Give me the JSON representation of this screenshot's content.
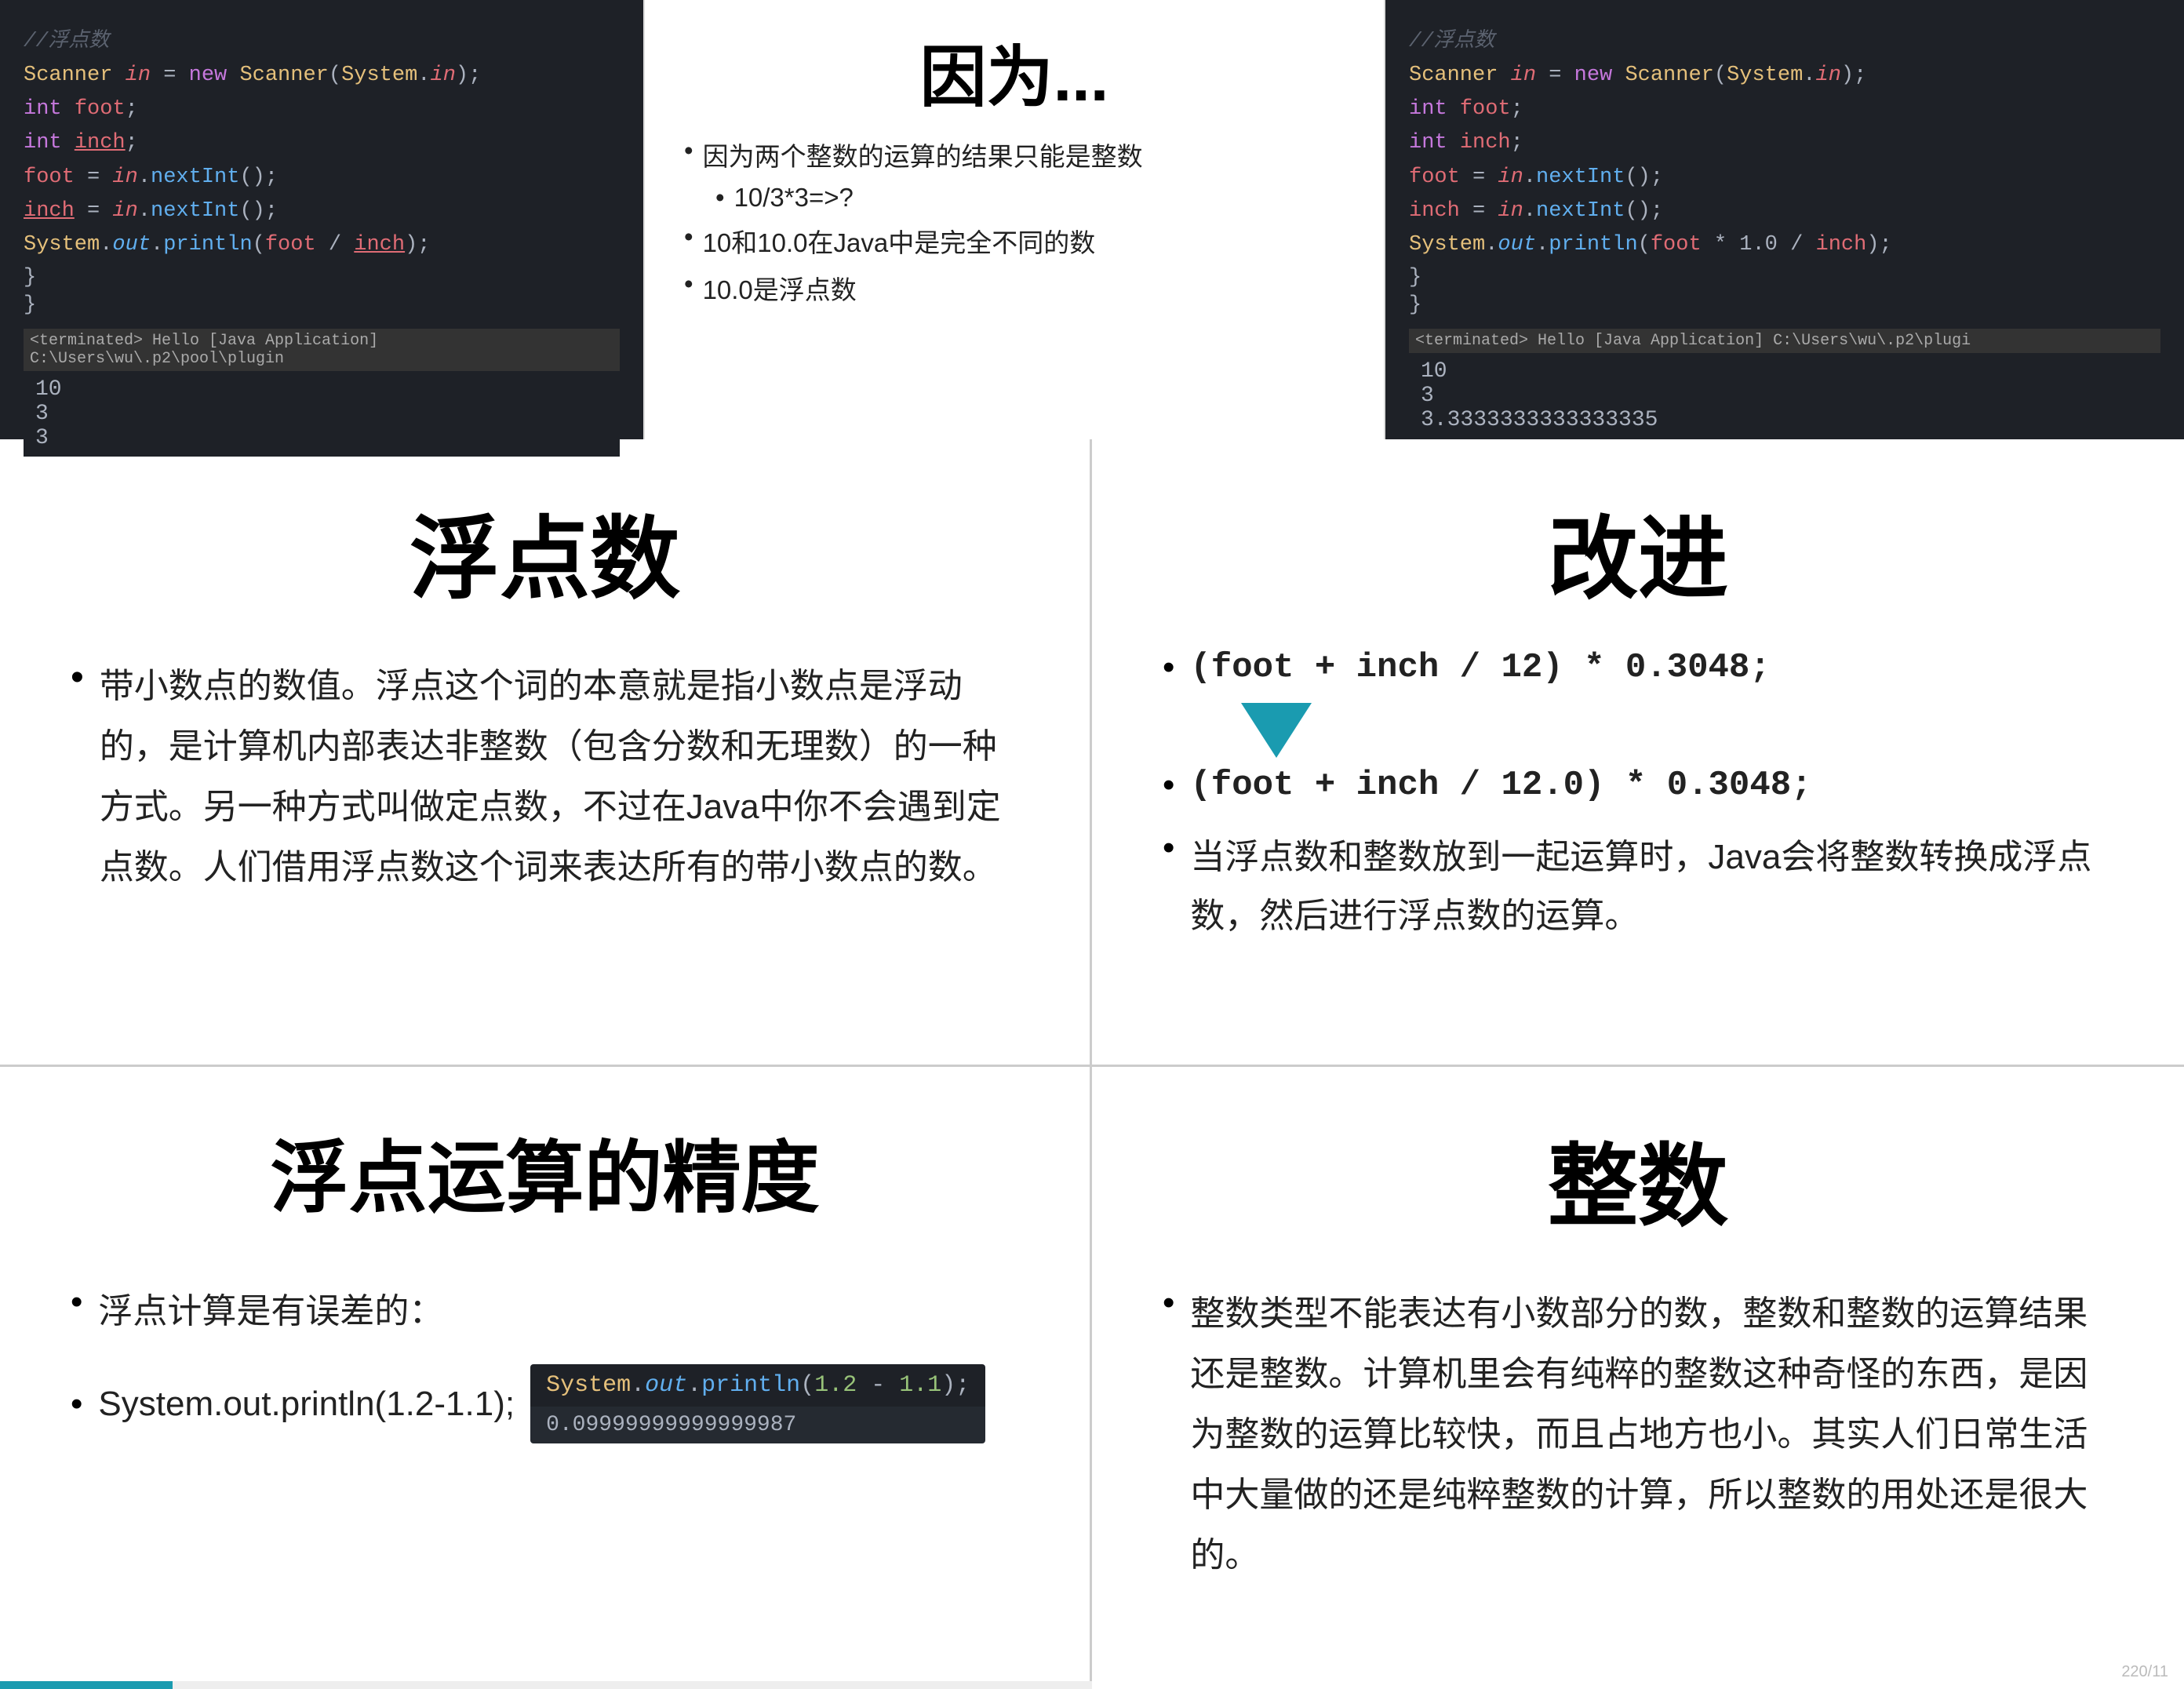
{
  "topLeft": {
    "comment": "//浮点数",
    "lines": [
      {
        "type": "code",
        "text": "Scanner in = new Scanner(System.in);"
      },
      {
        "type": "code",
        "text": "int foot;"
      },
      {
        "type": "code",
        "text": "int inch;"
      },
      {
        "type": "code",
        "text": "foot = in.nextInt();"
      },
      {
        "type": "code",
        "text": "inch = in.nextInt();"
      },
      {
        "type": "code",
        "text": "System.out.println(foot / inch);"
      }
    ],
    "terminal": "<terminated> Hello [Java Application] C:\\Users\\wu\\.p2\\pool\\plugin",
    "output": [
      "10",
      "3",
      "3"
    ]
  },
  "topMiddle": {
    "title": "因为...",
    "bullets": [
      "因为两个整数的运算的结果只能是整数",
      "10/3*3=>?",
      "10和10.0在Java中是完全不同的数",
      "10.0是浮点数"
    ]
  },
  "topRight": {
    "comment": "//浮点数",
    "lines": [
      {
        "text": "Scanner in = new Scanner(System.in);"
      },
      {
        "text": "int foot;"
      },
      {
        "text": "int inch;"
      },
      {
        "text": "foot = in.nextInt();"
      },
      {
        "text": "inch = in.nextInt();"
      },
      {
        "text": "System.out.println(foot * 1.0 / inch);"
      }
    ],
    "terminal": "<terminated> Hello [Java Application] C:\\Users\\wu\\.p2\\plugi",
    "output": [
      "10",
      "3",
      "3.3333333333333335"
    ]
  },
  "midLeft": {
    "title": "浮点数",
    "content": "带小数点的数值。浮点这个词的本意就是指小数点是浮动的，是计算机内部表达非整数（包含分数和无理数）的一种方式。另一种方式叫做定点数，不过在Java中你不会遇到定点数。人们借用浮点数这个词来表达所有的带小数点的数。"
  },
  "midRight": {
    "title": "改进",
    "bullet1": "(foot + inch / 12) * 0.3048;",
    "arrow": "↓",
    "bullet2": "(foot + inch / 12.0) * 0.3048;",
    "bullet3": "当浮点数和整数放到一起运算时，Java会将整数转换成浮点数，然后进行浮点数的运算。"
  },
  "bottomLeft": {
    "title": "浮点运算的精度",
    "bullet1": "浮点计算是有误差的：",
    "bullet2_prefix": "System.out.println(1.2-1.1);",
    "code_inline": "System.out.println(1.2 - 1.1);",
    "output_inline": "0.09999999999999987"
  },
  "bottomRight": {
    "title": "整数",
    "content": "整数类型不能表达有小数部分的数，整数和整数的运算结果还是整数。计算机里会有纯粹的整数这种奇怪的东西，是因为整数的运算比较快，而且占地方也小。其实人们日常生活中大量做的还是纯粹整数的计算，所以整数的用处还是很大的。"
  },
  "pageInfo": "220/11"
}
